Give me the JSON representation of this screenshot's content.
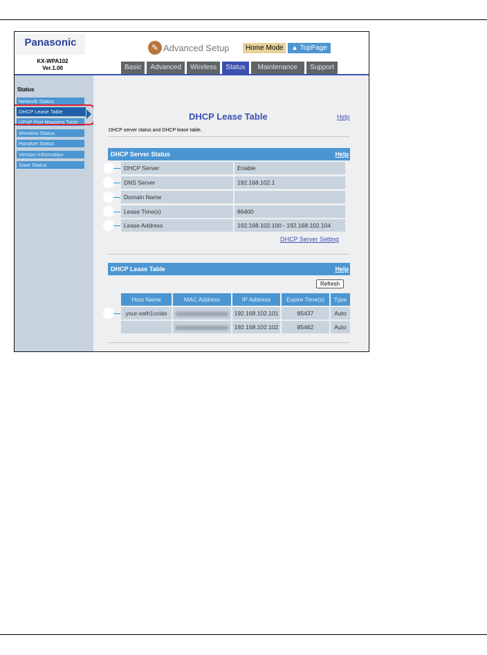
{
  "header": {
    "brand": "Panasonic",
    "model": "KX-WPA102",
    "version": "Ver.1.00",
    "title": "Advanced Setup",
    "home_mode": "Home Mode",
    "top_page": "TopPage"
  },
  "tabs": [
    "Basic",
    "Advanced",
    "Wireless",
    "Status",
    "Maintenance",
    "Support"
  ],
  "sidebar": {
    "heading": "Status",
    "items": [
      "Network Status",
      "DHCP Lease Table",
      "UPnP Port Mapping Table",
      "Wireless Status",
      "Handset Status",
      "Version Information",
      "Save Status"
    ]
  },
  "main": {
    "title": "DHCP Lease Table",
    "help": "Help",
    "description": "DHCP server status and DHCP lease table.",
    "server": {
      "heading": "DHCP Server Status",
      "rows": [
        {
          "label": "DHCP Server",
          "value": "Enable"
        },
        {
          "label": "DNS Server",
          "value": "192.168.102.1"
        },
        {
          "label": "Domain Name",
          "value": ""
        },
        {
          "label": "Lease Time(s)",
          "value": "86400"
        },
        {
          "label": "Lease Address",
          "value": "192.168.102.100 - 192.168.102.104"
        }
      ],
      "setting_link": "DHCP Server Setting"
    },
    "lease": {
      "heading": "DHCP Lease Table",
      "refresh": "Refresh",
      "columns": [
        "Host Name",
        "MAC Address",
        "IP Address",
        "Expire Time(s)",
        "Type"
      ],
      "rows": [
        {
          "host": "your-xath1vcido",
          "ip": "192.168.102.101",
          "expire": "85437",
          "type": "Auto"
        },
        {
          "host": "",
          "ip": "192.168.102.102",
          "expire": "85462",
          "type": "Auto"
        }
      ]
    }
  }
}
